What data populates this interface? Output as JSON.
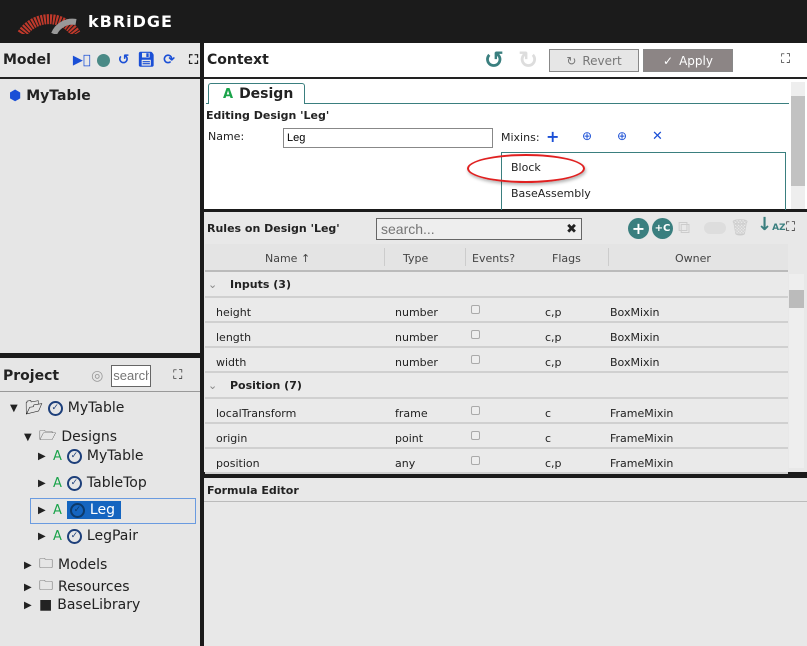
{
  "app": {
    "brand": "kBRiDGE"
  },
  "model": {
    "title": "Model",
    "item": "MyTable"
  },
  "project": {
    "title": "Project",
    "search_placeholder": "search",
    "tree": [
      {
        "label": "MyTable",
        "level": 0,
        "expanded": true
      },
      {
        "label": "Designs",
        "level": 1,
        "expanded": true
      },
      {
        "label": "MyTable",
        "level": 2
      },
      {
        "label": "TableTop",
        "level": 2
      },
      {
        "label": "Leg",
        "level": 2,
        "selected": true
      },
      {
        "label": "LegPair",
        "level": 2
      },
      {
        "label": "Models",
        "level": 1
      },
      {
        "label": "Resources",
        "level": 1
      },
      {
        "label": "BaseLibrary",
        "level": 1
      }
    ]
  },
  "context": {
    "title": "Context",
    "revert_label": "Revert",
    "apply_label": "Apply",
    "tab": "Design",
    "editing": "Editing Design 'Leg'",
    "name_label": "Name:",
    "name_value": "Leg",
    "mixins_label": "Mixins:",
    "mixins": [
      "Block",
      "BaseAssembly"
    ]
  },
  "rules": {
    "title": "Rules on Design 'Leg'",
    "search_placeholder": "search...",
    "columns": [
      "Name",
      "Type",
      "Events?",
      "Flags",
      "Owner"
    ],
    "groups": [
      {
        "label": "Inputs (3)",
        "rows": [
          {
            "name": "height",
            "type": "number",
            "flags": "c,p",
            "owner": "BoxMixin"
          },
          {
            "name": "length",
            "type": "number",
            "flags": "c,p",
            "owner": "BoxMixin"
          },
          {
            "name": "width",
            "type": "number",
            "flags": "c,p",
            "owner": "BoxMixin"
          }
        ]
      },
      {
        "label": "Position (7)",
        "rows": [
          {
            "name": "localTransform",
            "type": "frame",
            "flags": "c",
            "owner": "FrameMixin"
          },
          {
            "name": "origin",
            "type": "point",
            "flags": "c",
            "owner": "FrameMixin"
          },
          {
            "name": "position",
            "type": "any",
            "flags": "c,p",
            "owner": "FrameMixin"
          }
        ]
      }
    ]
  },
  "formula": {
    "title": "Formula Editor"
  },
  "colors": {
    "accent": "#3a7f7f",
    "highlight_ellipse": "#e02020",
    "selection": "#1565c0"
  }
}
